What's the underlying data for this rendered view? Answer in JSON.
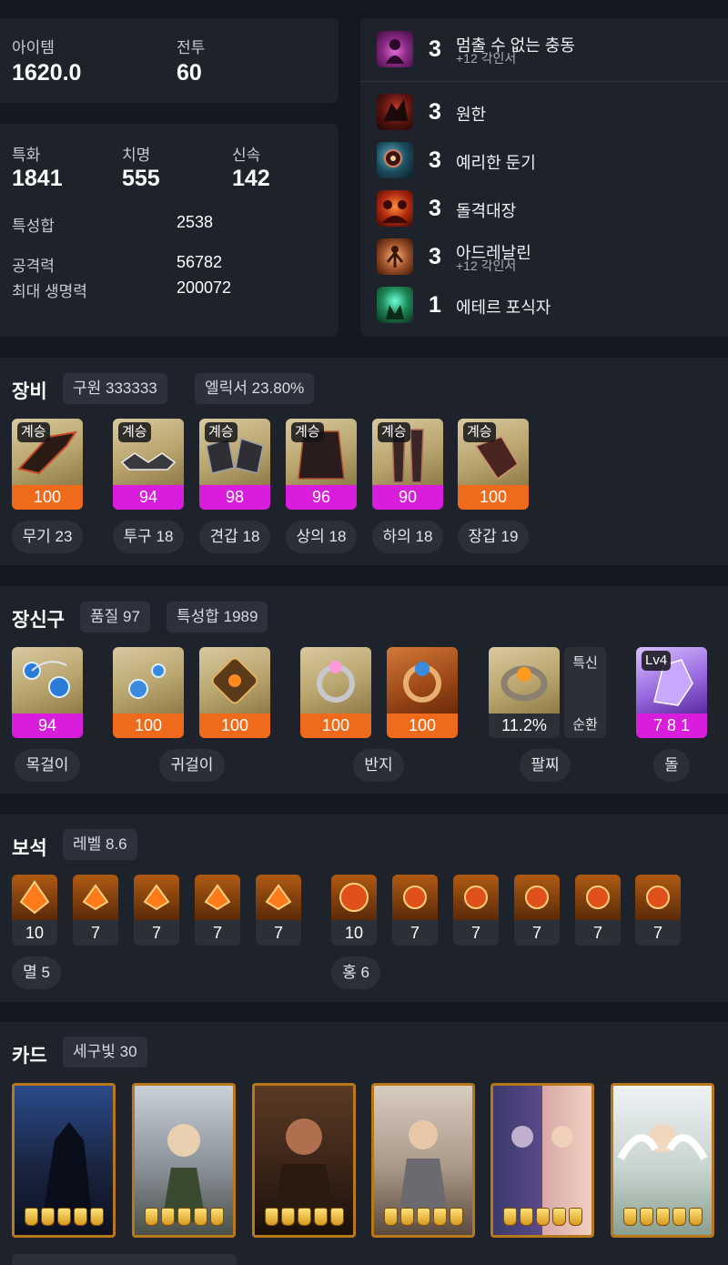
{
  "summary": {
    "item_level_label": "아이템",
    "item_level": "1620.0",
    "combat_label": "전투",
    "combat_level": "60"
  },
  "stats": {
    "special_label": "특화",
    "special": "1841",
    "crit_label": "치명",
    "crit": "555",
    "swift_label": "신속",
    "swift": "142",
    "total_label": "특성합",
    "total": "2538",
    "attack_label": "공격력",
    "attack": "56782",
    "hp_label": "최대 생명력",
    "hp": "200072"
  },
  "engravings": [
    {
      "level": "3",
      "name": "멈출 수 없는 충동",
      "sub": "+12 각인서",
      "icon": "unstoppable-impulse-icon"
    },
    {
      "level": "3",
      "name": "원한",
      "sub": "",
      "icon": "grudge-icon"
    },
    {
      "level": "3",
      "name": "예리한 둔기",
      "sub": "",
      "icon": "keen-blunt-weapon-icon"
    },
    {
      "level": "3",
      "name": "돌격대장",
      "sub": "",
      "icon": "raid-captain-icon"
    },
    {
      "level": "3",
      "name": "아드레날린",
      "sub": "+12 각인서",
      "icon": "adrenaline-icon"
    },
    {
      "level": "1",
      "name": "에테르 포식자",
      "sub": "",
      "icon": "ether-predator-icon"
    }
  ],
  "equipment": {
    "title": "장비",
    "chip_1": "구원 333333",
    "chip_2": "엘릭서 23.80%",
    "tag": "계승",
    "items": [
      {
        "quality": "100",
        "color": "orange",
        "label": "무기 23",
        "icon": "weapon-icon"
      },
      {
        "quality": "94",
        "color": "magenta",
        "label": "투구 18",
        "icon": "helmet-icon"
      },
      {
        "quality": "98",
        "color": "magenta",
        "label": "견갑 18",
        "icon": "shoulder-icon"
      },
      {
        "quality": "96",
        "color": "magenta",
        "label": "상의 18",
        "icon": "chest-icon"
      },
      {
        "quality": "90",
        "color": "magenta",
        "label": "하의 18",
        "icon": "pants-icon"
      },
      {
        "quality": "100",
        "color": "orange",
        "label": "장갑 19",
        "icon": "gloves-icon"
      }
    ]
  },
  "accessories": {
    "title": "장신구",
    "chip_1": "품질 97",
    "chip_2": "특성합 1989",
    "necklace": {
      "quality": "94",
      "label": "목걸이"
    },
    "earring_1": {
      "quality": "100"
    },
    "earring_2": {
      "quality": "100"
    },
    "earring_label": "귀걸이",
    "ring_1": {
      "quality": "100"
    },
    "ring_2": {
      "quality": "100"
    },
    "ring_label": "반지",
    "bracelet": {
      "value": "11.2%",
      "label": "팔찌",
      "stat_1": "특신",
      "stat_2": "순환"
    },
    "stone": {
      "tag": "Lv4",
      "value": "7 8 1",
      "label": "돌"
    }
  },
  "gems": {
    "title": "보석",
    "chip": "레벨 8.6",
    "annihilation": [
      "10",
      "7",
      "7",
      "7",
      "7"
    ],
    "annihilation_label": "멸 5",
    "crimson": [
      "10",
      "7",
      "7",
      "7",
      "7",
      "7"
    ],
    "crimson_label": "홍 6"
  },
  "cards": {
    "title": "카드",
    "chip": "세구빛 30",
    "count": 6
  },
  "colors": {
    "orange": "#ef6a1a",
    "magenta": "#d91ddd",
    "panel": "#1e222b",
    "background": "#15181f"
  }
}
